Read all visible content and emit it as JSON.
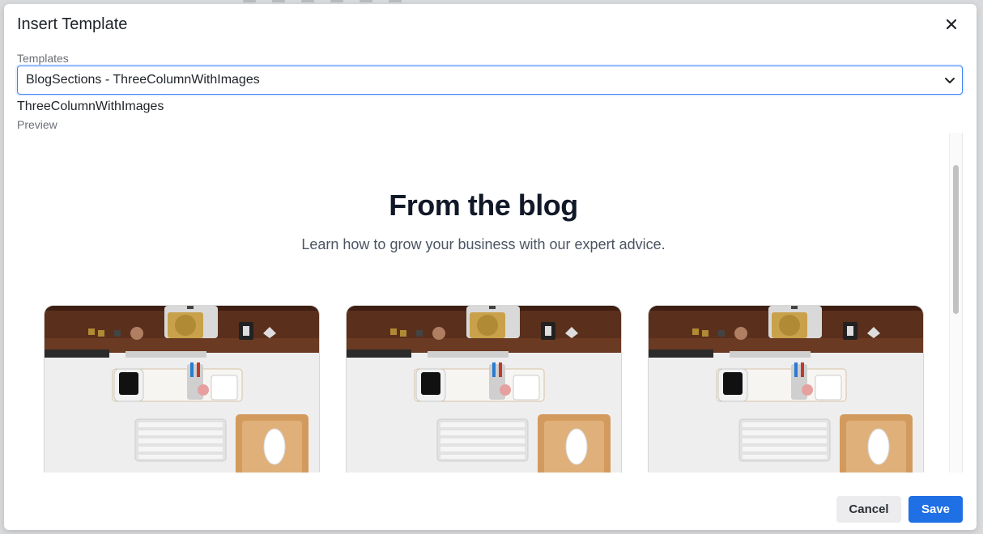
{
  "modal": {
    "title": "Insert Template",
    "close_icon": "close-icon"
  },
  "templates": {
    "label": "Templates",
    "selected": "BlogSections - ThreeColumnWithImages",
    "chevron_icon": "chevron-down-icon"
  },
  "template_name": "ThreeColumnWithImages",
  "preview": {
    "label": "Preview",
    "title": "From the blog",
    "subtitle": "Learn how to grow your business with our expert advice.",
    "cards": [
      {
        "image": "desk-workspace-photo"
      },
      {
        "image": "desk-workspace-photo"
      },
      {
        "image": "desk-workspace-photo"
      }
    ]
  },
  "actions": {
    "cancel_label": "Cancel",
    "save_label": "Save"
  },
  "colors": {
    "primary": "#1f6fe5",
    "focus_border": "#3b82f6"
  }
}
